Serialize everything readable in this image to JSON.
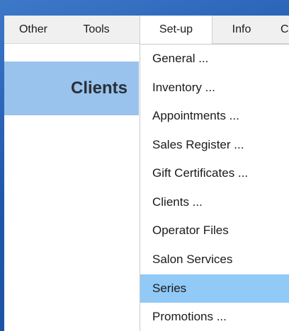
{
  "menubar": {
    "items": [
      {
        "label": "Other"
      },
      {
        "label": "Tools"
      },
      {
        "label": "Set-up"
      },
      {
        "label": "Info"
      },
      {
        "label": "C"
      }
    ],
    "active": "Set-up"
  },
  "panel": {
    "title": "Clients"
  },
  "setup_menu": {
    "items": [
      {
        "label": "General ..."
      },
      {
        "label": "Inventory ..."
      },
      {
        "label": "Appointments ..."
      },
      {
        "label": "Sales Register ..."
      },
      {
        "label": "Gift Certificates ..."
      },
      {
        "label": "Clients ..."
      },
      {
        "label": "Operator Files"
      },
      {
        "label": "Salon Services"
      },
      {
        "label": "Series"
      },
      {
        "label": "Promotions ..."
      }
    ],
    "selected": "Series"
  },
  "colors": {
    "desktop": "#1f58ab",
    "panel": "#99c2ec",
    "menu_highlight": "#91c9f7"
  }
}
